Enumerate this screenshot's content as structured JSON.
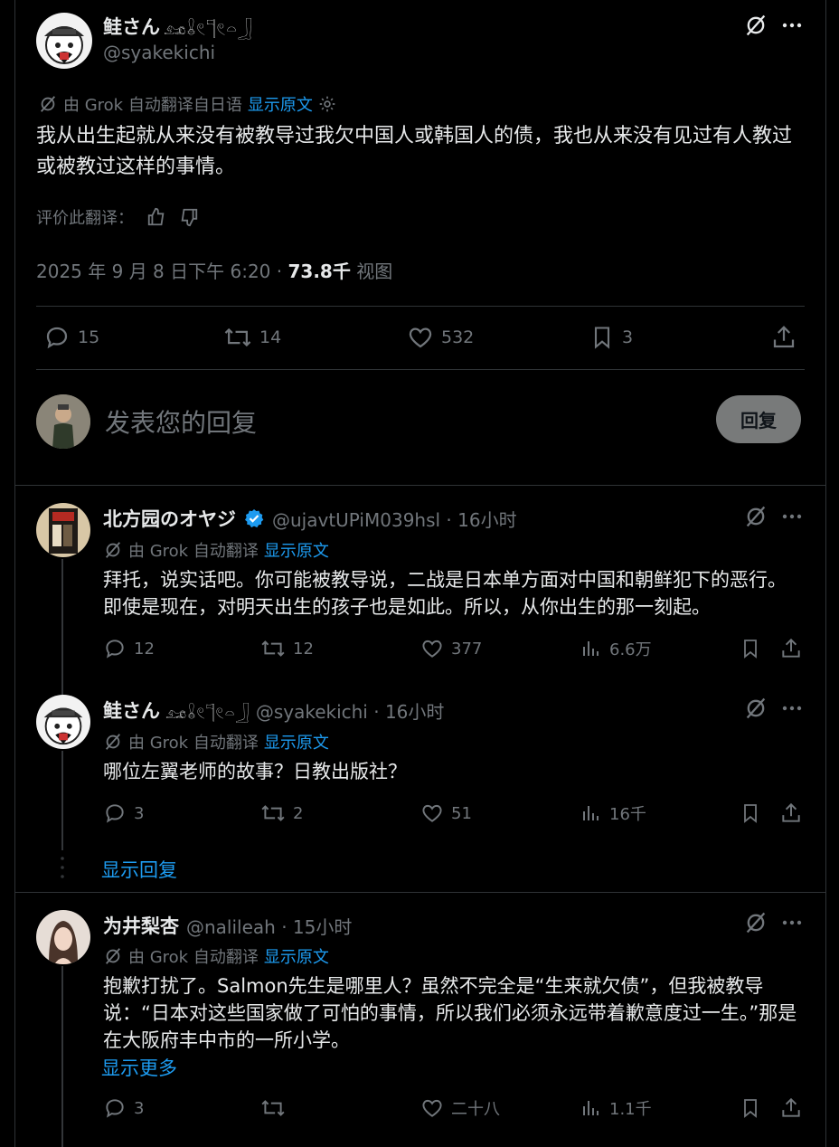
{
  "main_post": {
    "author_name": "鲑さん",
    "author_glyphs": "𓃭𓏇𓏲𓊹𓏲𓏏𓃀",
    "handle": "@syakekichi",
    "translated_note": "由 Grok 自动翻译自日语",
    "show_original": "显示原文",
    "text": "我从出生起就从来没有被教导过我欠中国人或韩国人的债，我也从来没有见过有人教过或被教过这样的事情。",
    "rate_label": "评价此翻译：",
    "date": "2025 年 9 月 8 日下午 6:20 · ",
    "views": "73.8千",
    "views_label": " 视图",
    "replies": "15",
    "retweets": "14",
    "likes": "532",
    "bookmarks": "3"
  },
  "reply_box": {
    "placeholder": "发表您的回复",
    "button": "回复"
  },
  "replies": [
    {
      "author_name": "北方园のオヤジ",
      "handle": "@ujavtUPiM039hsl · 16小时",
      "translated_note": "由 Grok 自动翻译",
      "show_original": "显示原文",
      "text": "拜托，说实话吧。你可能被教导说，二战是日本单方面对中国和朝鲜犯下的恶行。即使是现在，对明天出生的孩子也是如此。所以，从你出生的那一刻起。",
      "replies": "12",
      "retweets": "12",
      "likes": "377",
      "views": "6.6万"
    },
    {
      "author_name": "鲑さん",
      "author_glyphs": "𓃭𓏇𓏲𓊹𓏲𓏏𓃀",
      "handle": "@syakekichi · 16小时",
      "translated_note": "由 Grok 自动翻译",
      "show_original": "显示原文",
      "text": "哪位左翼老师的故事？日教出版社？",
      "replies": "3",
      "retweets": "2",
      "likes": "51",
      "views": "16千"
    },
    {
      "author_name": "为井梨杏",
      "handle": "@nalileah · 15小时",
      "translated_note": "由 Grok 自动翻译",
      "show_original": "显示原文",
      "text": "抱歉打扰了。Salmon先生是哪里人？虽然不完全是“生来就欠债”，但我被教导说：“日本对这些国家做了可怕的事情，所以我们必须永远带着歉意度过一生。”那是在大阪府丰中市的一所小学。",
      "show_more": "显示更多",
      "replies": "3",
      "retweets": "",
      "likes": "二十八",
      "views": "1.1千"
    }
  ],
  "show_replies": "显示回复",
  "colors": {
    "accent": "#1d9bf0",
    "muted": "#71767b",
    "text": "#e7e9ea",
    "border": "#2f3336"
  }
}
